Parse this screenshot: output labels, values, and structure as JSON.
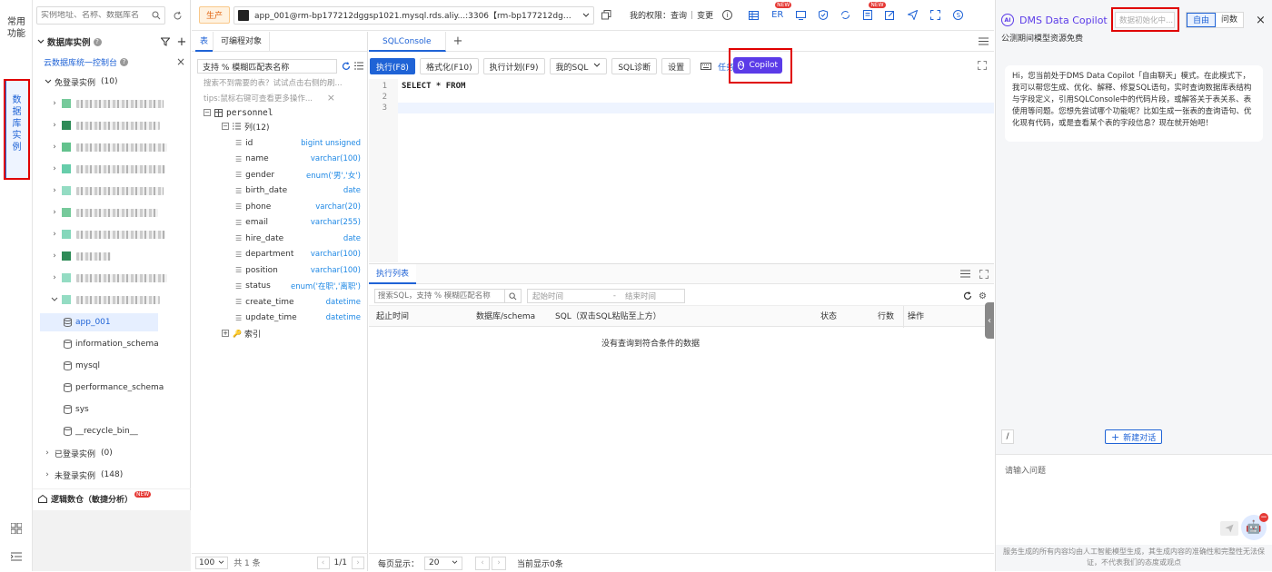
{
  "leftnav": {
    "common": "常用功能",
    "db_instances": "数据库实例"
  },
  "instance_panel": {
    "search_placeholder": "实例地址、名称、数据库名",
    "title": "数据库实例",
    "console_link": "云数据库统一控制台",
    "free_login": "免登录实例",
    "free_login_count": "(10)",
    "selected_db": "app_001",
    "databases": [
      "information_schema",
      "mysql",
      "performance_schema",
      "sys",
      "__recycle_bin__"
    ],
    "logged_in": "已登录实例",
    "logged_in_count": "(0)",
    "not_logged": "未登录实例",
    "not_logged_count": "(148)",
    "logic_db": "逻辑数仓（敏捷分析）",
    "new_badge": "NEW"
  },
  "topbar": {
    "env_tag": "生产",
    "connection": "app_001@rm-bp177212dggsp1021.mysql.rds.aliy...:3306【rm-bp177212dggsp1021】",
    "permission_label": "我的权限：",
    "perm_query": "查询",
    "perm_sep": "|",
    "perm_change": "变更",
    "er_label": "ER",
    "new_badge": "NEW"
  },
  "table_panel": {
    "tabs": [
      "表",
      "可编程对象"
    ],
    "search_value": "支持 % 模糊匹配表名称",
    "hint1": "搜索不到需要的表？试试点击右侧的刷...",
    "hint2": "tips:鼠标右键可查看更多操作...",
    "table_name": "personnel",
    "columns_label": "列(12)",
    "columns": [
      {
        "name": "id",
        "type": "bigint unsigned"
      },
      {
        "name": "name",
        "type": "varchar(100)"
      },
      {
        "name": "gender",
        "type": "enum('男','女')"
      },
      {
        "name": "birth_date",
        "type": "date"
      },
      {
        "name": "phone",
        "type": "varchar(20)"
      },
      {
        "name": "email",
        "type": "varchar(255)"
      },
      {
        "name": "hire_date",
        "type": "date"
      },
      {
        "name": "department",
        "type": "varchar(100)"
      },
      {
        "name": "position",
        "type": "varchar(100)"
      },
      {
        "name": "status",
        "type": "enum('在职','离职')"
      },
      {
        "name": "create_time",
        "type": "datetime"
      },
      {
        "name": "update_time",
        "type": "datetime"
      }
    ],
    "index_label": "索引",
    "page_size": "100",
    "total": "共 1 条",
    "page": "1/1"
  },
  "console": {
    "tab": "SQLConsole",
    "toolbar": {
      "execute": "执行(F8)",
      "format": "格式化(F10)",
      "plan": "执行计划(F9)",
      "my_sql": "我的SQL",
      "diagnose": "SQL诊断",
      "settings": "设置",
      "task": "任务编排",
      "copilot": "Copilot"
    },
    "line_numbers": [
      "1",
      "2",
      "3"
    ],
    "code_line1": "SELECT * FROM"
  },
  "exec_list": {
    "tab": "执行列表",
    "search_placeholder": "搜索SQL，支持 % 模糊匹配名称",
    "start_placeholder": "起始时间",
    "range_sep": "-",
    "end_placeholder": "结束时间",
    "headers": [
      "起止时间",
      "数据库/schema",
      "SQL（双击SQL粘贴至上方）",
      "状态",
      "行数",
      "操作"
    ],
    "empty": "没有查询到符合条件的数据",
    "per_page_label": "每页显示：",
    "per_page": "20",
    "current": "当前显示0条"
  },
  "copilot": {
    "title": "DMS Data Copilot",
    "status": "数据初始化中...",
    "mode_free": "自由",
    "mode_ask": "问数",
    "subtitle": "公测期间模型资源免费",
    "message": "Hi，您当前处于DMS Data Copilot「自由聊天」模式。在此模式下，我可以帮您生成、优化、解释、修复SQL语句，实时查询数据库表结构与字段定义，引用SQLConsole中的代码片段，或解答关于表关系、表使用等问题。您想先尝试哪个功能呢？比如生成一张表的查询语句、优化现有代码，或是查看某个表的字段信息？现在就开始吧！",
    "slash": "/",
    "new_chat": "新建对话",
    "input_placeholder": "请输入问题",
    "footer": "服务生成的所有内容均由人工智能模型生成，其生成内容的准确性和完整性无法保证，不代表我们的态度或观点"
  },
  "colors": {
    "brand_blue": "#1f63d6",
    "copilot_purple": "#5b3be8",
    "env_tag_bg": "#fff2e0",
    "env_tag_text": "#e0620d",
    "type_blue": "#1e88e5",
    "highlight_red": "#e00000"
  }
}
